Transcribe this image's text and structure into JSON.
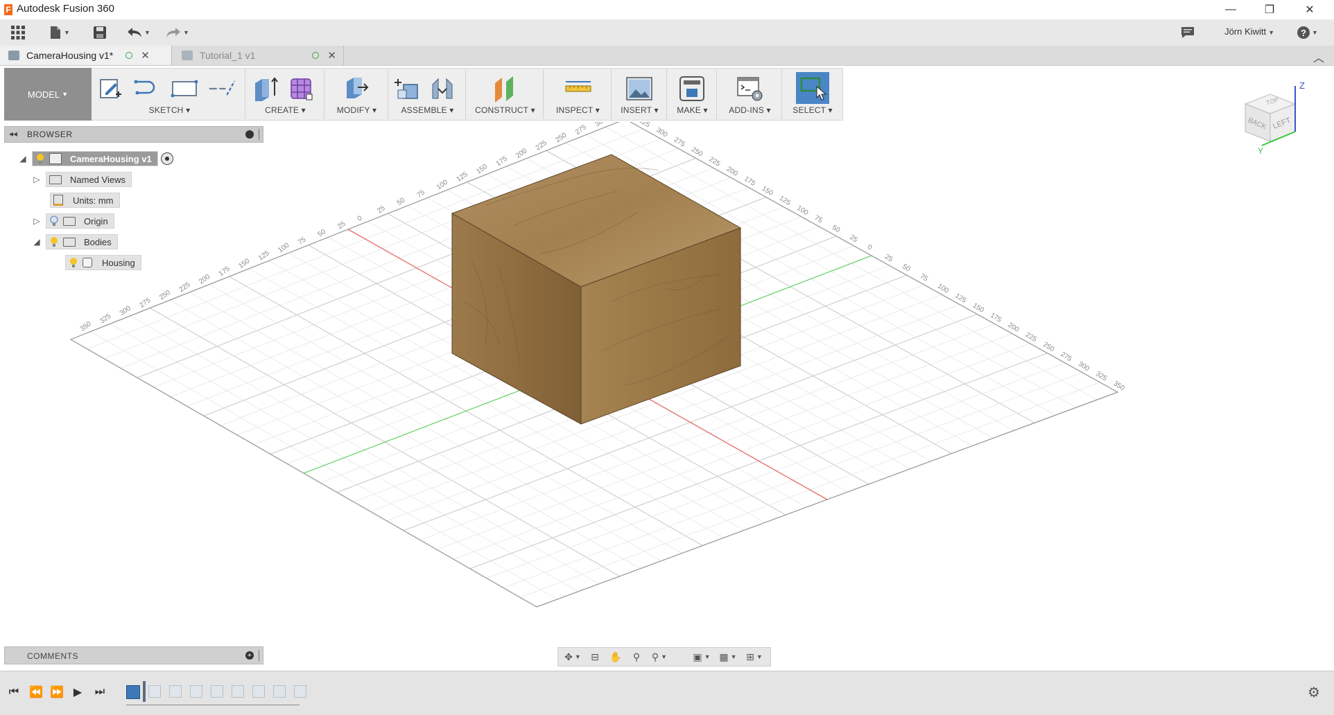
{
  "window": {
    "title": "Autodesk Fusion 360",
    "logo_letter": "F",
    "minimize_glyph": "—",
    "restore_glyph": "❐",
    "close_glyph": "✕"
  },
  "quick_access": {
    "user_name": "Jörn Kiwitt",
    "help_glyph": "?"
  },
  "tabs": [
    {
      "label": "CameraHousing v1*",
      "active": true
    },
    {
      "label": "Tutorial_1 v1",
      "active": false
    }
  ],
  "ribbon": {
    "mode": "MODEL",
    "groups": [
      {
        "label": "SKETCH"
      },
      {
        "label": "CREATE"
      },
      {
        "label": "MODIFY"
      },
      {
        "label": "ASSEMBLE"
      },
      {
        "label": "CONSTRUCT"
      },
      {
        "label": "INSPECT"
      },
      {
        "label": "INSERT"
      },
      {
        "label": "MAKE"
      },
      {
        "label": "ADD-INS"
      },
      {
        "label": "SELECT"
      }
    ]
  },
  "browser": {
    "title": "BROWSER",
    "root": "CameraHousing v1",
    "nodes": [
      "Named Views",
      "Units: mm",
      "Origin",
      "Bodies",
      "Housing"
    ]
  },
  "viewcube": {
    "faces": [
      "BACK",
      "LEFT",
      "TOP"
    ],
    "axes": [
      "Z",
      "Y"
    ]
  },
  "grid": {
    "left_axis_ticks": [
      "350",
      "325",
      "300",
      "275",
      "250",
      "225",
      "200",
      "175",
      "150",
      "125",
      "100",
      "75",
      "50",
      "25",
      "0",
      "25",
      "50",
      "75",
      "100",
      "125",
      "150",
      "175",
      "200",
      "225",
      "250",
      "275",
      "300",
      "325"
    ],
    "right_axis_ticks": [
      "325",
      "300",
      "275",
      "250",
      "225",
      "200",
      "175",
      "150",
      "125",
      "100",
      "75",
      "50",
      "25",
      "0",
      "25",
      "50",
      "75",
      "100",
      "125",
      "150",
      "175",
      "200",
      "225",
      "250",
      "275",
      "300",
      "325",
      "350"
    ]
  },
  "comments": {
    "title": "COMMENTS"
  },
  "colors": {
    "accent_blue": "#3d78b8",
    "select_active": "#4a86c5",
    "wood_light": "#a9875a",
    "wood_mid": "#8c6a40",
    "wood_dark": "#6e5231",
    "axis_red": "#e56a6a",
    "axis_green": "#6cd36c"
  }
}
